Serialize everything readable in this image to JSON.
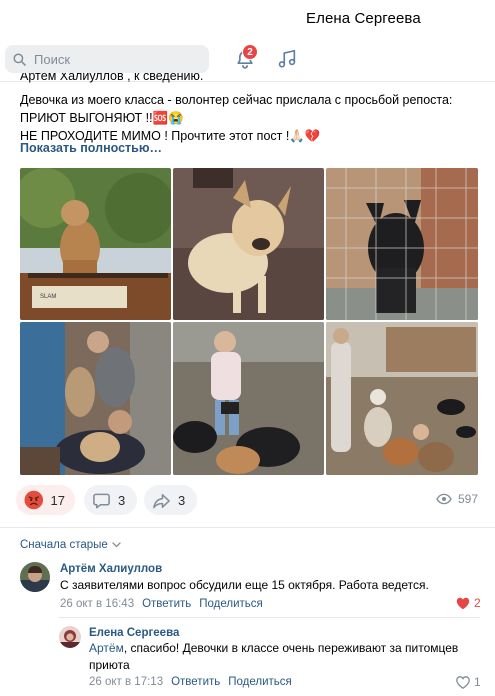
{
  "header": {
    "user_name": "Елена Сергеева",
    "search_placeholder": "Поиск",
    "notifications_count": "2"
  },
  "post": {
    "cut_line": "Артём Халиуллов , к сведению.",
    "lines": [
      "Девочка из моего класса - волонтер сейчас прислала с просьбой репоста:",
      "ПРИЮТ ВЫГОНЯЮТ !!🆘😭",
      "НЕ ПРОХОДИТЕ МИМО ! Прочтите этот пост !🙏🏻💔"
    ],
    "show_more": "Показать полностью…",
    "photo_sign": "SLAM"
  },
  "actions": {
    "reactions": "17",
    "comments": "3",
    "shares": "3",
    "views": "597"
  },
  "comments": {
    "sort_label": "Сначала старые",
    "items": [
      {
        "author": "Артём Халиуллов",
        "text": "С заявителями вопрос обсудили еще 15 октября. Работа ведется.",
        "date": "26 окт в 16:43",
        "reply": "Ответить",
        "share": "Поделиться",
        "likes": "2"
      },
      {
        "author": "Елена Сергеева",
        "mention": "Артём",
        "text": ", спасибо! Девочки в классе очень переживают за питомцев приюта",
        "date": "26 окт в 17:13",
        "reply": "Ответить",
        "share": "Поделиться",
        "likes": "1"
      }
    ]
  },
  "colors": {
    "link": "#2a5885",
    "badge": "#e64646",
    "muted": "#818c99"
  }
}
